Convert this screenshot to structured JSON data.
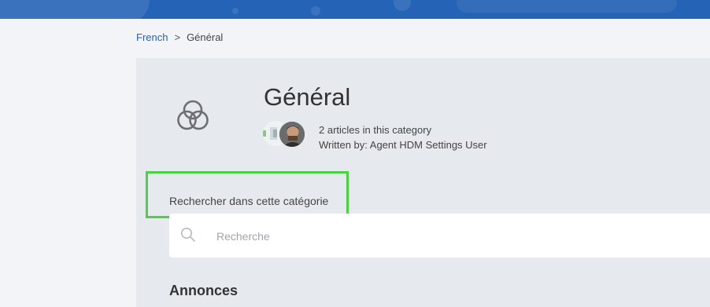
{
  "breadcrumb": {
    "parent": "French",
    "separator": ">",
    "current": "Général"
  },
  "category": {
    "icon": "overlapping-circles-icon",
    "title": "Général",
    "articles_count_text": "2 articles in this category",
    "written_by_text": "Written by: Agent HDM Settings User"
  },
  "search": {
    "label": "Rechercher dans cette catégorie",
    "placeholder": "Recherche",
    "value": ""
  },
  "sections": {
    "announcements_heading": "Annonces"
  },
  "colors": {
    "header_bar": "#2563b6",
    "link": "#2563b6",
    "highlight_box": "#4bd144",
    "panel_bg": "#e6e9ee"
  }
}
